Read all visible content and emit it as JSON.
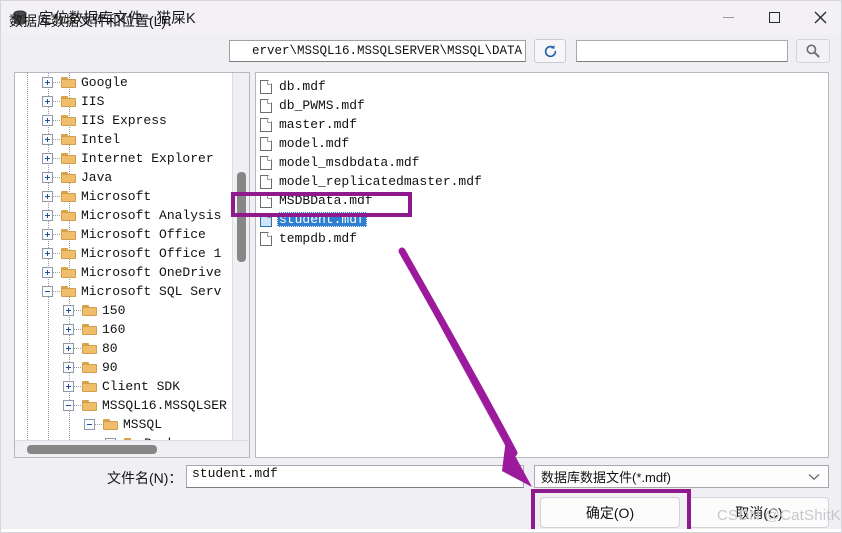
{
  "window": {
    "title": "定位数据库文件 - 猫屎K",
    "icon": "database-icon",
    "controls": {
      "minimize": "minimize-icon",
      "maximize": "maximize-icon",
      "close": "close-icon"
    }
  },
  "toolbar": {
    "location_label": "数据库数据文件和位置(L)：",
    "path_value": "erver\\MSSQL16.MSSQLSERVER\\MSSQL\\DATA",
    "refresh_icon": "refresh-icon",
    "search_value": "",
    "search_placeholder": "",
    "search_icon": "search-icon"
  },
  "tree": {
    "items": [
      {
        "label": "Google",
        "indent": 1,
        "state": "collapsed"
      },
      {
        "label": "IIS",
        "indent": 1,
        "state": "collapsed"
      },
      {
        "label": "IIS Express",
        "indent": 1,
        "state": "collapsed"
      },
      {
        "label": "Intel",
        "indent": 1,
        "state": "collapsed"
      },
      {
        "label": "Internet Explorer",
        "indent": 1,
        "state": "collapsed"
      },
      {
        "label": "Java",
        "indent": 1,
        "state": "collapsed"
      },
      {
        "label": "Microsoft",
        "indent": 1,
        "state": "collapsed"
      },
      {
        "label": "Microsoft Analysis",
        "indent": 1,
        "state": "collapsed"
      },
      {
        "label": "Microsoft Office",
        "indent": 1,
        "state": "collapsed"
      },
      {
        "label": "Microsoft Office 1",
        "indent": 1,
        "state": "collapsed"
      },
      {
        "label": "Microsoft OneDrive",
        "indent": 1,
        "state": "collapsed"
      },
      {
        "label": "Microsoft SQL Serv",
        "indent": 1,
        "state": "expanded"
      },
      {
        "label": "150",
        "indent": 2,
        "state": "collapsed"
      },
      {
        "label": "160",
        "indent": 2,
        "state": "collapsed"
      },
      {
        "label": "80",
        "indent": 2,
        "state": "collapsed"
      },
      {
        "label": "90",
        "indent": 2,
        "state": "collapsed"
      },
      {
        "label": "Client SDK",
        "indent": 2,
        "state": "collapsed"
      },
      {
        "label": "MSSQL16.MSSQLSER",
        "indent": 2,
        "state": "expanded"
      },
      {
        "label": "MSSQL",
        "indent": 3,
        "state": "expanded"
      },
      {
        "label": "Backup",
        "indent": 4,
        "state": "collapsed"
      }
    ]
  },
  "files": {
    "items": [
      {
        "name": "db.mdf",
        "selected": false
      },
      {
        "name": "db_PWMS.mdf",
        "selected": false
      },
      {
        "name": "master.mdf",
        "selected": false
      },
      {
        "name": "model.mdf",
        "selected": false
      },
      {
        "name": "model_msdbdata.mdf",
        "selected": false
      },
      {
        "name": "model_replicatedmaster.mdf",
        "selected": false
      },
      {
        "name": "MSDBData.mdf",
        "selected": false
      },
      {
        "name": "student.mdf",
        "selected": true
      },
      {
        "name": "tempdb.mdf",
        "selected": false
      }
    ]
  },
  "footer": {
    "filename_label": "文件名(N)：",
    "filename_value": "student.mdf",
    "filter_value": "数据库数据文件(*.mdf)",
    "filter_caret_icon": "chevron-down-icon",
    "ok_label": "确定(O)",
    "cancel_label": "取消(C)"
  },
  "annotations": {
    "highlight_color": "#8e1a8e",
    "watermark": "CSDN @CatShitK",
    "arrow_icon": "arrow-pointer-icon"
  }
}
